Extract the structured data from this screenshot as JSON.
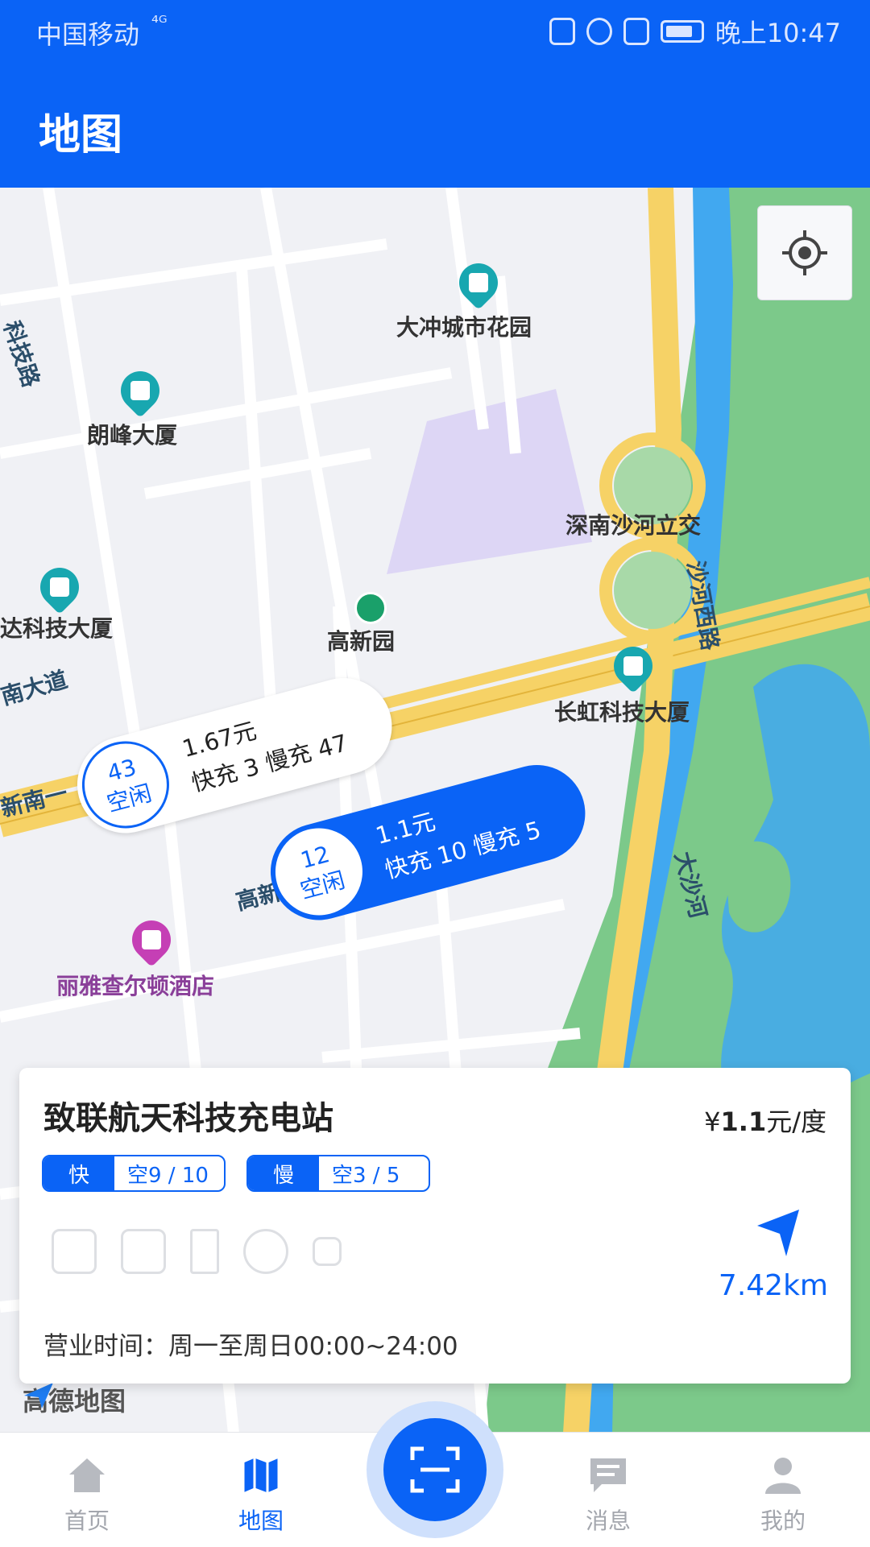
{
  "status_bar": {
    "carrier": "中国移动",
    "signal_label": "⁴ᴳ",
    "time": "晚上10:47"
  },
  "header": {
    "title": "地图"
  },
  "map": {
    "pois": [
      {
        "name": "大冲城市花园"
      },
      {
        "name": "朗峰大厦"
      },
      {
        "name": "深南沙河立交"
      },
      {
        "name": "达科技大厦"
      },
      {
        "name": "高新园"
      },
      {
        "name": "长虹科技大厦"
      },
      {
        "name": "丽雅查尔顿酒店"
      }
    ],
    "roads": [
      {
        "name": "科技路"
      },
      {
        "name": "南大道"
      },
      {
        "name": "新南一"
      },
      {
        "name": "高新南"
      },
      {
        "name": "沙河西路"
      },
      {
        "name": "大沙河"
      }
    ],
    "markers": [
      {
        "count": "43",
        "status": "空闲",
        "price": "1.67元",
        "detail": "快充 3 慢充 47"
      },
      {
        "count": "12",
        "status": "空闲",
        "price": "1.1元",
        "detail": "快充 10 慢充 5"
      }
    ],
    "logo": "高德地图"
  },
  "station": {
    "name": "致联航天科技充电站",
    "price_symbol": "¥",
    "price_value": "1.1",
    "price_unit": "元/度",
    "fast_label": "快",
    "fast_value": "空9 / 10",
    "slow_label": "慢",
    "slow_value": "空3 / 5",
    "distance": "7.42km",
    "hours": "营业时间：周一至周日00:00~24:00",
    "amenities": [
      "restroom-icon",
      "parking-icon",
      "dining-icon",
      "lounge-icon",
      "canopy-icon"
    ]
  },
  "bottom_nav": [
    {
      "label": "首页",
      "icon": "home-icon"
    },
    {
      "label": "地图",
      "icon": "map-icon"
    },
    {
      "label": "消息",
      "icon": "message-icon"
    },
    {
      "label": "我的",
      "icon": "profile-icon"
    }
  ],
  "colors": {
    "accent": "#0a63f6",
    "map_water": "#41a8f0",
    "map_green": "#7cc98a",
    "map_highway": "#f6d266"
  }
}
